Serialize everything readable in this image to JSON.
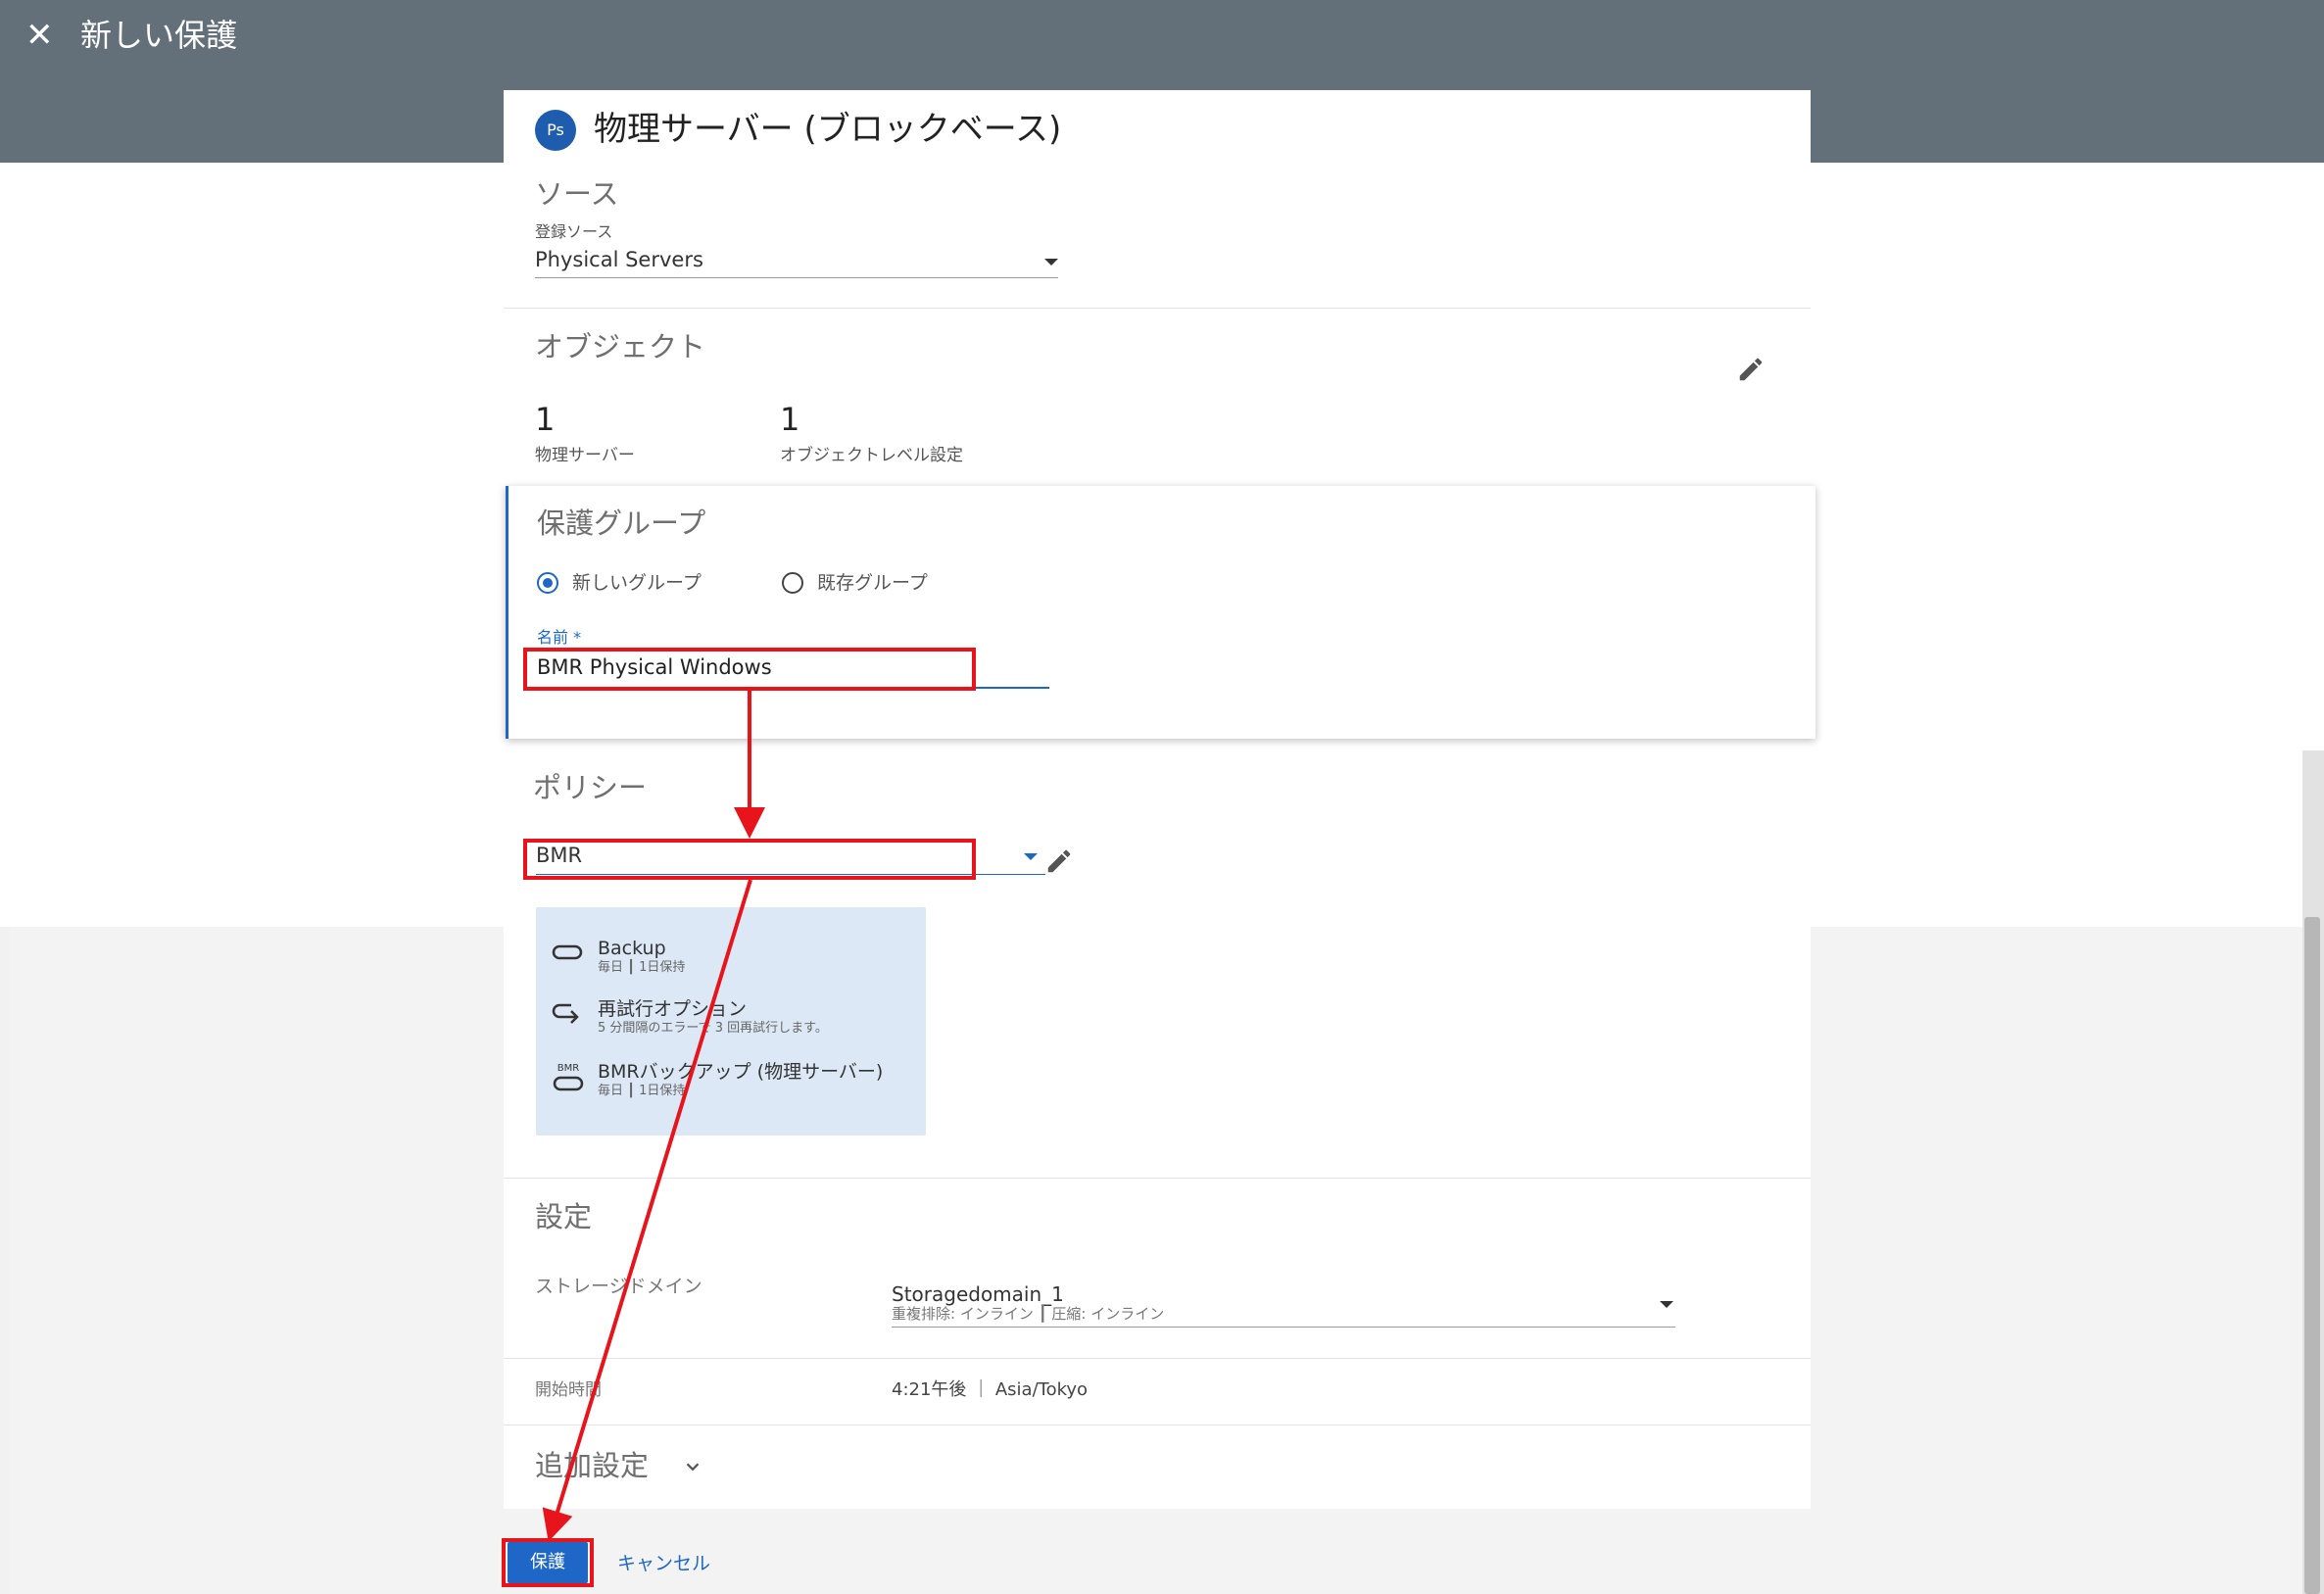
{
  "header": {
    "close_icon": "close-icon",
    "title": "新しい保護"
  },
  "workload": {
    "badge": "Ps",
    "title": "物理サーバー (ブロックベース)"
  },
  "source": {
    "heading": "ソース",
    "field_label": "登録ソース",
    "value": "Physical Servers"
  },
  "objects": {
    "heading": "オブジェクト",
    "stats": [
      {
        "value": "1",
        "label": "物理サーバー"
      },
      {
        "value": "1",
        "label": "オブジェクトレベル設定"
      }
    ]
  },
  "protection_group": {
    "heading": "保護グループ",
    "options": [
      {
        "label": "新しいグループ",
        "selected": true
      },
      {
        "label": "既存グループ",
        "selected": false
      }
    ],
    "name_label": "名前 *",
    "name_value": "BMR Physical Windows"
  },
  "policy": {
    "heading": "ポリシー",
    "value": "BMR",
    "details": [
      {
        "icon": "backup-icon",
        "name": "Backup",
        "sub": "毎日 ┃ 1日保持"
      },
      {
        "icon": "retry-icon",
        "name": "再試行オプション",
        "sub": "5 分間隔のエラーで 3 回再試行します。"
      },
      {
        "icon": "bmr-backup-icon",
        "name": "BMRバックアップ (物理サーバー)",
        "sub": "毎日 ┃ 1日保持"
      }
    ]
  },
  "settings": {
    "heading": "設定",
    "storage_label": "ストレージドメイン",
    "storage_value": "Storagedomain_1",
    "storage_sub": "重複排除: インライン ┃ 圧縮: インライン",
    "start_label": "開始時間",
    "start_value": "4:21午後 ｜ Asia/Tokyo"
  },
  "additional": {
    "heading": "追加設定"
  },
  "actions": {
    "protect": "保護",
    "cancel": "キャンセル"
  },
  "colors": {
    "header": "#647079",
    "accent": "#1e67c7",
    "annotation": "#e8141c",
    "policy_box": "#dce8f5"
  }
}
